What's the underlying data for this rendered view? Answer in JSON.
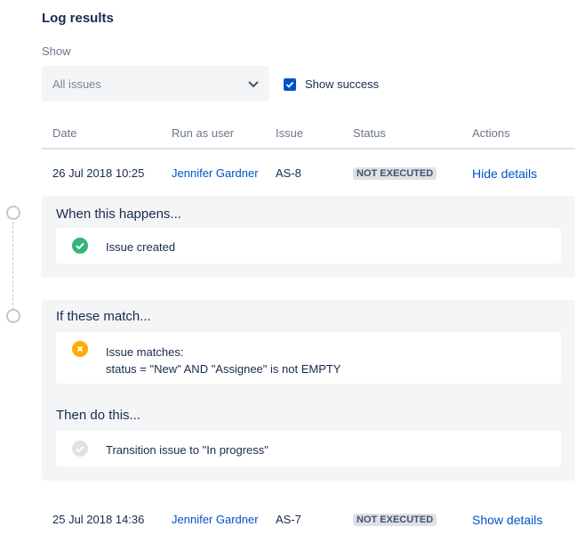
{
  "header": {
    "title": "Log results"
  },
  "filters": {
    "show_label": "Show",
    "select_value": "All issues",
    "show_success_label": "Show success",
    "show_success_checked": true
  },
  "table": {
    "columns": [
      "Date",
      "Run as user",
      "Issue",
      "Status",
      "Actions"
    ],
    "rows": [
      {
        "date": "26 Jul 2018 10:25",
        "user": "Jennifer Gardner",
        "issue": "AS-8",
        "status": "NOT EXECUTED",
        "action": "Hide details"
      },
      {
        "date": "25 Jul 2018 14:36",
        "user": "Jennifer Gardner",
        "issue": "AS-7",
        "status": "NOT EXECUTED",
        "action": "Show details"
      }
    ]
  },
  "details": {
    "when": {
      "title": "When this happens...",
      "item": {
        "text": "Issue created",
        "state": "success",
        "icon": "check-circle-icon"
      }
    },
    "if": {
      "title": "If these match...",
      "item": {
        "line1": "Issue matches:",
        "line2": "status = \"New\" AND \"Assignee\" is not EMPTY",
        "state": "failed",
        "icon": "cross-circle-icon"
      }
    },
    "then": {
      "title": "Then do this...",
      "item": {
        "text": "Transition issue to \"In progress\"",
        "state": "skipped",
        "icon": "check-circle-grey-icon"
      }
    }
  },
  "colors": {
    "link": "#0052cc",
    "success": "#36b37e",
    "warning": "#ffab00",
    "muted": "#c1c7d0",
    "panel": "#f4f5f7"
  }
}
